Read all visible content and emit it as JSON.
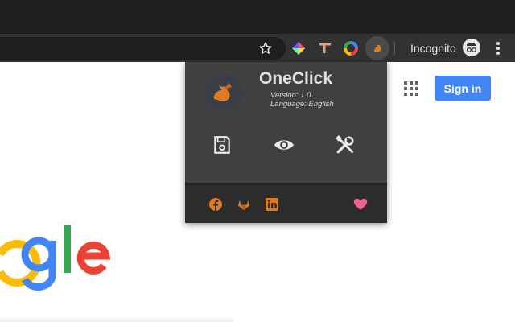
{
  "browser": {
    "incognito_label": "Incognito"
  },
  "page": {
    "signin_label": "Sign in",
    "logo_text_visible": "ogle"
  },
  "popup": {
    "title": "OneClick",
    "version": "Version: 1.0",
    "language": "Language: English",
    "actions": [
      "save-icon",
      "eye-icon",
      "tools-icon"
    ],
    "footer_links": [
      "facebook-icon",
      "gitlab-icon",
      "linkedin-icon"
    ],
    "accent": "#e07b1f",
    "heart_color": "#f06292"
  }
}
